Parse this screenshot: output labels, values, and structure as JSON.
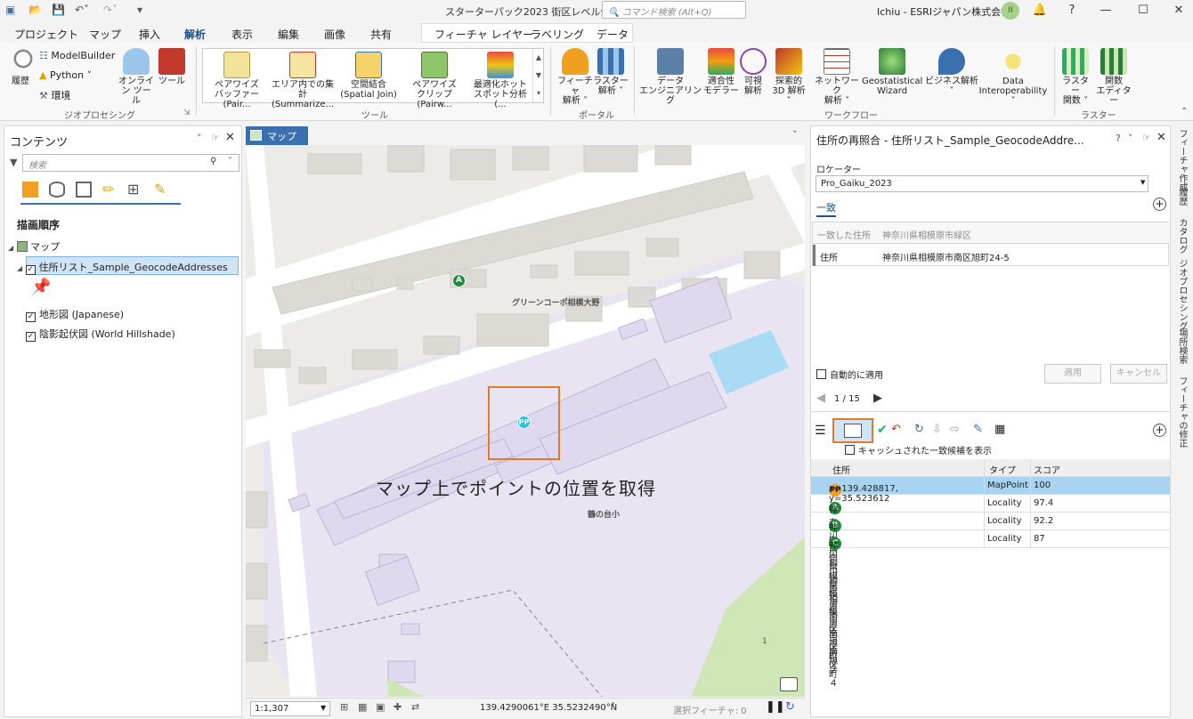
{
  "window": {
    "title": "スターターパック2023 街区レベル住所",
    "command_search_placeholder": "コマンド検索 (Alt+Q)",
    "user": "Ichiu - ESRIジャパン株式会社",
    "avatar_initials": "II"
  },
  "tabs": [
    "プロジェクト",
    "マップ",
    "挿入",
    "解析",
    "表示",
    "編集",
    "画像",
    "共有"
  ],
  "active_tab": "解析",
  "context_tabs": [
    "フィーチャ レイヤー",
    "ラベリング",
    "データ"
  ],
  "ribbon": {
    "geoprocessing": {
      "history": "履歴",
      "modelbuilder": "ModelBuilder",
      "python": "Python",
      "environments": "環境",
      "online_tools": "オンライン ツール",
      "tools": "ツール",
      "label": "ジオプロセシング"
    },
    "tools_gallery": {
      "items": [
        {
          "line1": "ペアワイズ",
          "line2": "バッファー (Pair..."
        },
        {
          "line1": "エリア内での集計",
          "line2": "(Summarize..."
        },
        {
          "line1": "空間結合",
          "line2": "(Spatial Join)"
        },
        {
          "line1": "ペアワイズ",
          "line2": "クリップ (Pairw..."
        },
        {
          "line1": "最適化ホット",
          "line2": "スポット分析 (..."
        }
      ],
      "label": "ツール"
    },
    "portal": {
      "items": [
        {
          "line1": "フィーチャ",
          "line2": "解析"
        },
        {
          "line1": "ラスター",
          "line2": "解析"
        }
      ],
      "label": "ポータル"
    },
    "workflow": {
      "items": [
        {
          "line1": "データ",
          "line2": "エンジニアリング"
        },
        {
          "line1": "適合性",
          "line2": "モデラー"
        },
        {
          "line1": "可視",
          "line2": "解析"
        },
        {
          "line1": "探索的",
          "line2": "3D 解析"
        },
        {
          "line1": "ネットワーク",
          "line2": "解析"
        },
        {
          "line1": "Geostatistical",
          "line2": "Wizard"
        },
        {
          "line1": "ビジネス解析",
          "line2": ""
        },
        {
          "line1": "Data",
          "line2": "Interoperability"
        }
      ],
      "label": "ワークフロー"
    },
    "raster": {
      "items": [
        {
          "line1": "ラスター",
          "line2": "関数"
        },
        {
          "line1": "関数",
          "line2": "エディター"
        }
      ],
      "label": "ラスター"
    }
  },
  "contents": {
    "title": "コンテンツ",
    "search_placeholder": "検索",
    "draw_order": "描画順序",
    "map": "マップ",
    "layers": [
      {
        "name": "住所リスト_Sample_GeocodeAddresses",
        "checked": true
      },
      {
        "name": "地形図 (Japanese)",
        "checked": true
      },
      {
        "name": "陰影起伏図 (World Hillshade)",
        "checked": true
      }
    ]
  },
  "map": {
    "tab": "マップ",
    "labels": {
      "building1": "グリーンコーポ相模大野",
      "building2": "鶴の台小",
      "marker_a": "A",
      "marker_pp": "PP",
      "lot_number": "1"
    },
    "annotation": "マップ上でポイントの位置を取得",
    "scale": "1:1,307",
    "coordinates": "139.4290061°E 35.5232490°N",
    "selected_features": "選択フィーチャ: 0"
  },
  "rematch": {
    "title": "住所の再照合 - 住所リスト_Sample_GeocodeAddre...",
    "locator_label": "ロケーター",
    "locator_value": "Pro_Gaiku_2023",
    "match_tab": "一致",
    "matched_address_label": "一致した住所",
    "matched_address_value": "神奈川県相模原市緑区",
    "address_label": "住所",
    "address_value": "神奈川県相模原市南区旭町24-5",
    "auto_apply": "自動的に適用",
    "apply": "適用",
    "cancel": "キャンセル",
    "pager": "1 / 15",
    "show_cached": "キャッシュされた一致候補を表示",
    "columns": [
      "住所",
      "タイプ",
      "スコア"
    ],
    "candidates": [
      {
        "badge": "PP",
        "address": "x=139.428817, y=35.523612",
        "type": "MapPoint",
        "score": "100"
      },
      {
        "badge": "A",
        "address": "神奈川県相模原市南区旭町２４",
        "type": "Locality",
        "score": "97.4"
      },
      {
        "badge": "B",
        "address": "神奈川県相模原市南区旭町",
        "type": "Locality",
        "score": "92.2"
      },
      {
        "badge": "C",
        "address": "神奈川県相模原市南区",
        "type": "Locality",
        "score": "87"
      }
    ]
  },
  "side_tabs": [
    "フィーチャ作成",
    "履歴",
    "カタログ",
    "ジオプロセシング",
    "場所検索",
    "フィーチャの修正"
  ],
  "colors": {
    "accent": "#3a6fb0",
    "highlight_orange": "#e07b2c",
    "selected_row": "#a8d4f2",
    "marker_green": "#1e8a3a",
    "pp_cyan": "#23c3e6",
    "pp_orange": "#f0a020"
  }
}
